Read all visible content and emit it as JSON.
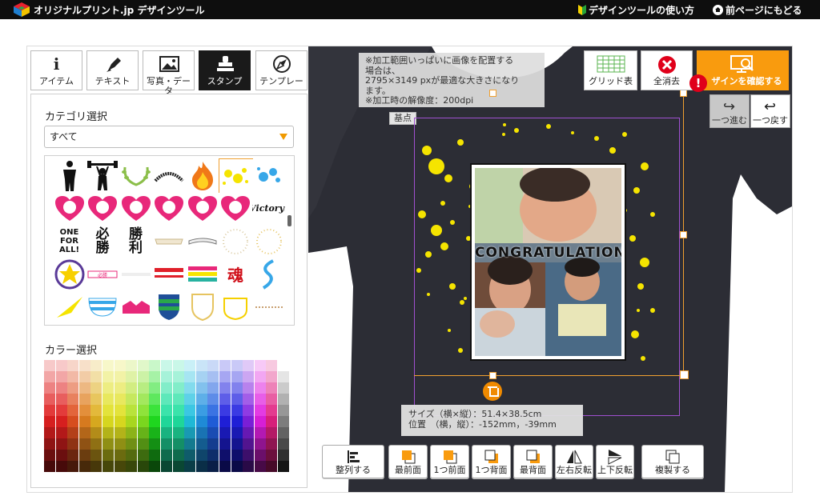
{
  "topbar": {
    "title": "オリジナルプリント.jp デザインツール",
    "howto": "デザインツールの使い方",
    "back": "前ページにもどる"
  },
  "tabs": [
    {
      "label": "アイテム",
      "icon": "info-icon"
    },
    {
      "label": "テキスト",
      "icon": "pen-icon"
    },
    {
      "label": "写真・データ",
      "icon": "image-icon"
    },
    {
      "label": "スタンプ",
      "icon": "stamp-icon",
      "active": true
    },
    {
      "label": "テンプレー",
      "icon": "compass-icon"
    }
  ],
  "panel": {
    "category_title": "カテゴリ選択",
    "category_value": "すべて",
    "color_title": "カラー選択"
  },
  "stamps": [
    {
      "name": "athlete"
    },
    {
      "name": "weightlifter"
    },
    {
      "name": "laurel"
    },
    {
      "name": "arch-text"
    },
    {
      "name": "flame"
    },
    {
      "name": "yellow-splash",
      "selected": true
    },
    {
      "name": "blue-splash"
    },
    {
      "name": "heart-rugby"
    },
    {
      "name": "heart-soccer"
    },
    {
      "name": "heart-volleyball"
    },
    {
      "name": "heart-baseball"
    },
    {
      "name": "heart-volleyball-2"
    },
    {
      "name": "heart-basketball"
    },
    {
      "name": "victory-text",
      "text": "Victory!"
    },
    {
      "name": "one-for-all",
      "text": "ONE FOR ALL!"
    },
    {
      "name": "hissho",
      "text": "必勝"
    },
    {
      "name": "shouri",
      "text": "勝利"
    },
    {
      "name": "ribbon-1"
    },
    {
      "name": "ribbon-2"
    },
    {
      "name": "dots-circle"
    },
    {
      "name": "dots-circle-2"
    },
    {
      "name": "star-badge"
    },
    {
      "name": "banner-red"
    },
    {
      "name": "banner-text"
    },
    {
      "name": "stripes-red"
    },
    {
      "name": "stripes-multi"
    },
    {
      "name": "tamashii",
      "text": "魂"
    },
    {
      "name": "wave-blue"
    },
    {
      "name": "wing-yellow"
    },
    {
      "name": "stripes-blue"
    },
    {
      "name": "crown-pink"
    },
    {
      "name": "shield-green"
    },
    {
      "name": "shield-outline"
    },
    {
      "name": "frame-yellow"
    },
    {
      "name": "dots-line"
    }
  ],
  "canvas": {
    "notice": "※加工範囲いっぱいに画像を配置する\n場合は、\n2795×3149 pxが最適な大きさになり\nます。\n※加工時の解像度：200dpi",
    "base_point": "基点",
    "photo_caption": "CONGRATULATIONS",
    "size_line": "サイズ（横×縦）：51.4×38.5cm",
    "position_line": "位置　（横，縦）：-152mm，-39mm"
  },
  "tools": {
    "grid": "グリッド表",
    "clear": "全消去",
    "confirm": "ザインを確認する",
    "redo": "一つ進む",
    "undo": "一つ戻す"
  },
  "bottom": {
    "align": "整列する",
    "front": "最前面",
    "forward": "1つ前面",
    "backward": "1つ背面",
    "back": "最背面",
    "flip_h": "左右反転",
    "flip_v": "上下反転",
    "duplicate": "複製する"
  },
  "colors": {
    "accent": "#f99b0e",
    "shirt": "#2c2d35",
    "alert": "#e0001a",
    "print_area": "#a050d0",
    "splash": "#f5e400"
  }
}
